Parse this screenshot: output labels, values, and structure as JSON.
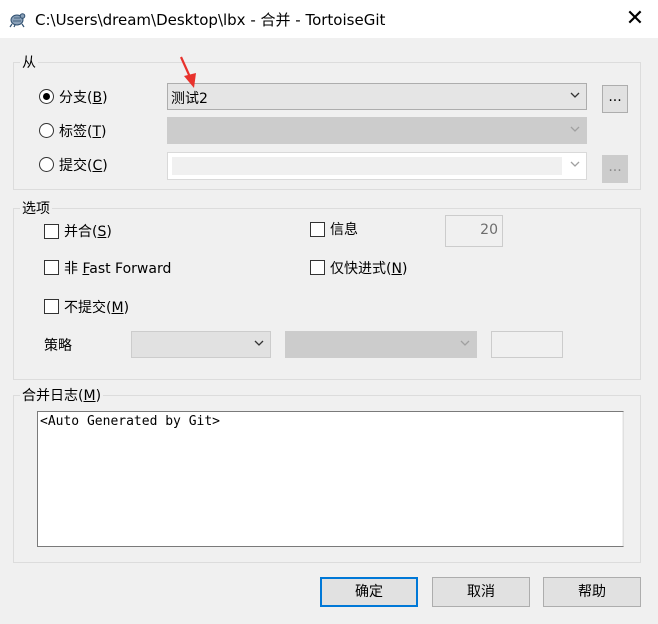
{
  "window": {
    "title": "C:\\Users\\dream\\Desktop\\lbx - 合并 - TortoiseGit",
    "app_icon": "tortoise-icon",
    "close_glyph": "✕"
  },
  "from_group": {
    "legend": "从",
    "branch": {
      "label_prefix": "分支(",
      "accel": "B",
      "label_suffix": ")",
      "selected": true,
      "value": "测试2",
      "browse": "..."
    },
    "tag": {
      "label_prefix": "标签(",
      "accel": "T",
      "label_suffix": ")",
      "selected": false,
      "value": ""
    },
    "commit": {
      "label_prefix": "提交(",
      "accel": "C",
      "label_suffix": ")",
      "selected": false,
      "value": "",
      "browse": "..."
    }
  },
  "options_group": {
    "legend": "选项",
    "squash": {
      "label_prefix": "并合(",
      "accel": "S",
      "label_suffix": ")",
      "checked": false
    },
    "no_ff": {
      "label_prefix": "非 ",
      "accel": "F",
      "label_suffix": "ast Forward",
      "checked": false
    },
    "no_commit": {
      "label_prefix": "不提交(",
      "accel": "M",
      "label_suffix": ")",
      "checked": false
    },
    "log": {
      "label": "信息",
      "checked": false,
      "count": "20"
    },
    "ff_only": {
      "label_prefix": "仅快进式(",
      "accel": "N",
      "label_suffix": ")",
      "checked": false
    },
    "strategy_label": "策略",
    "strategy_value": "",
    "strategy_option": "",
    "strategy_param": ""
  },
  "log_group": {
    "legend_prefix": "合并日志(",
    "accel": "M",
    "legend_suffix": ")",
    "message": "<Auto Generated by Git>"
  },
  "buttons": {
    "ok": "确定",
    "cancel": "取消",
    "help": "帮助"
  },
  "colors": {
    "accent": "#0078d7",
    "dialog_bg": "#f0f0f0",
    "annotation_arrow": "#e8322c"
  }
}
